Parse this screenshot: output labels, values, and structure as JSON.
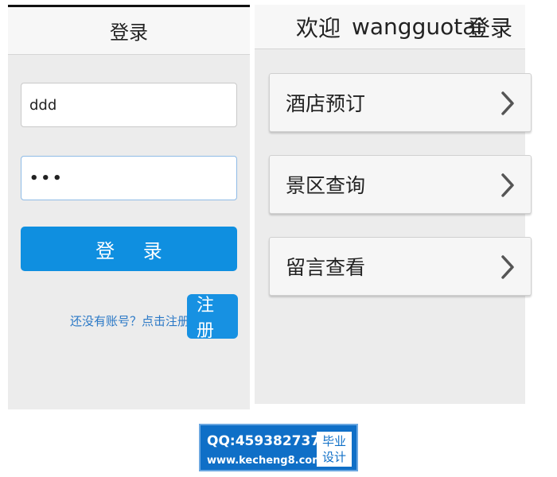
{
  "login_screen": {
    "title": "登录",
    "username_value": "ddd",
    "password_value": "•••",
    "login_button_label": "登 录",
    "register_hint": "还没有账号？点击注册！",
    "register_button_label": "注 册",
    "accent_color": "#0f8fe0"
  },
  "home_screen": {
    "welcome_text": "欢迎",
    "username": "wangguotai",
    "login_link": "登录",
    "menu_items": [
      {
        "label": "酒店预订",
        "icon": "chevron-right-icon"
      },
      {
        "label": "景区查询",
        "icon": "chevron-right-icon"
      },
      {
        "label": "留言查看",
        "icon": "chevron-right-icon"
      }
    ]
  },
  "watermark": {
    "qq_line": "QQ:459382737",
    "url_line": "www.kecheng8.com",
    "badge_line_1": "毕业",
    "badge_line_2": "设计",
    "color": "#0f6fc7"
  }
}
